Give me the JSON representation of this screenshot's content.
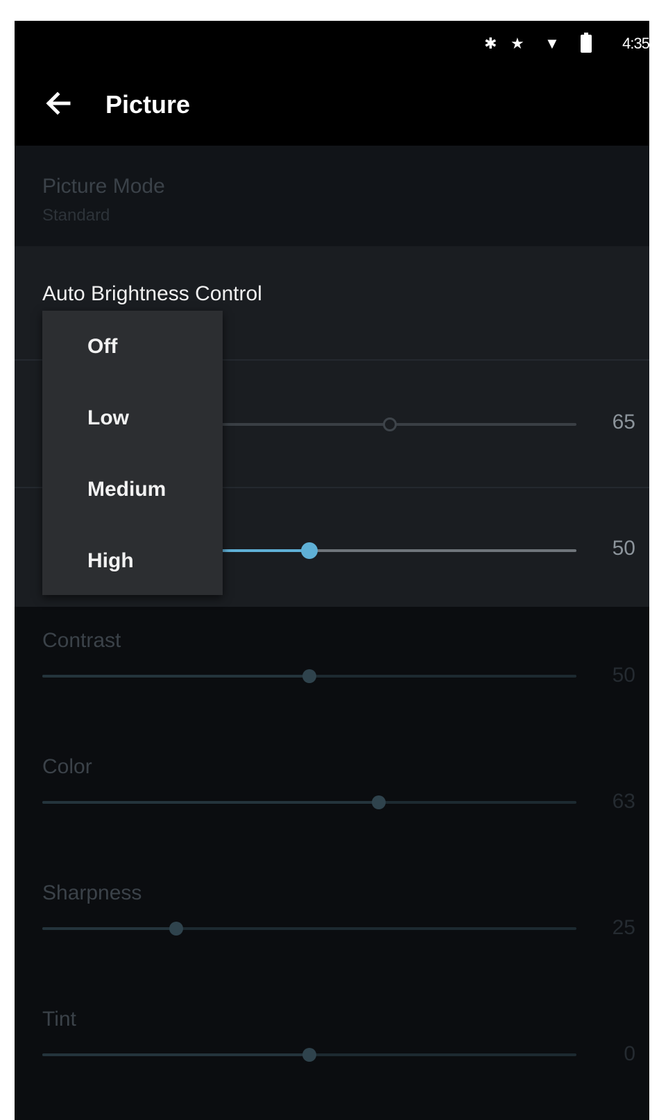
{
  "status_bar": {
    "time": "4:35",
    "icons": [
      "bluetooth-icon",
      "star-icon",
      "wifi-icon",
      "battery-icon"
    ]
  },
  "app_bar": {
    "title": "Picture",
    "back_icon": "arrow-left-icon"
  },
  "picture_mode": {
    "label": "Picture Mode",
    "value": "Standard"
  },
  "auto_brightness": {
    "label": "Auto Brightness Control",
    "options": [
      "Off",
      "Low",
      "Medium",
      "High"
    ]
  },
  "partially_hidden_sliders": [
    {
      "value": "65",
      "level": 0.65
    },
    {
      "value": "50",
      "level": 0.5
    }
  ],
  "sliders": [
    {
      "label": "Contrast",
      "value": "50",
      "level": 0.5
    },
    {
      "label": "Color",
      "value": "63",
      "level": 0.63
    },
    {
      "label": "Sharpness",
      "value": "25",
      "level": 0.25
    },
    {
      "label": "Tint",
      "value": "0",
      "level": 0.5
    }
  ],
  "colors": {
    "accent": "#5fb0d6",
    "dim_accent": "#3f5d6c"
  }
}
